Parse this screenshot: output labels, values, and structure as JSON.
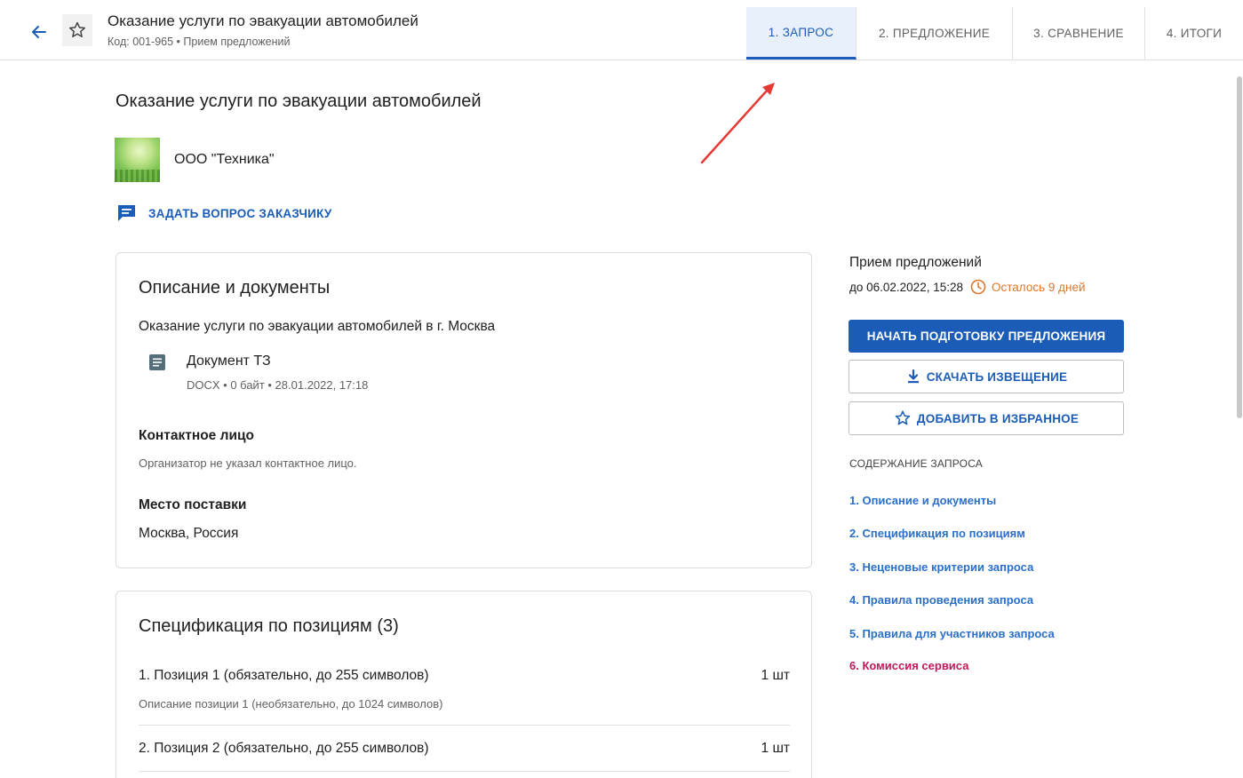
{
  "header": {
    "title": "Оказание услуги по эвакуации автомобилей",
    "subtitle": "Код: 001-965 • Прием предложений",
    "tabs": [
      {
        "label": "1. ЗАПРОС",
        "active": true
      },
      {
        "label": "2. ПРЕДЛОЖЕНИЕ",
        "active": false
      },
      {
        "label": "3. СРАВНЕНИЕ",
        "active": false
      },
      {
        "label": "4. ИТОГИ",
        "active": false
      }
    ]
  },
  "main": {
    "title": "Оказание услуги по эвакуации автомобилей",
    "organization": "ООО \"Техника\"",
    "ask_question_label": "ЗАДАТЬ ВОПРОС ЗАКАЗЧИКУ",
    "description_card": {
      "title": "Описание и документы",
      "text": "Оказание услуги по эвакуации автомобилей в г. Москва",
      "document_name": "Документ ТЗ",
      "document_meta": "DOCX  • 0 байт  • 28.01.2022, 17:18",
      "contact_label": "Контактное лицо",
      "contact_note": "Организатор не указал контактное лицо.",
      "delivery_label": "Место поставки",
      "delivery_value": "Москва, Россия"
    },
    "spec_card": {
      "title": "Спецификация по позициям (3)",
      "items": [
        {
          "name": "1. Позиция 1 (обязательно, до 255 символов)",
          "qty": "1 шт",
          "desc": "Описание позиции 1 (необязательно, до 1024 символов)"
        },
        {
          "name": "2. Позиция 2 (обязательно, до 255 символов)",
          "qty": "1 шт",
          "desc": ""
        }
      ]
    }
  },
  "sidebar": {
    "stage": "Прием предложений",
    "deadline": "до 06.02.2022, 15:28",
    "time_left": "Осталось 9 дней",
    "start_button": "НАЧАТЬ ПОДГОТОВКУ ПРЕДЛОЖЕНИЯ",
    "download_button": "СКАЧАТЬ ИЗВЕЩЕНИЕ",
    "favorite_button": "ДОБАВИТЬ В ИЗБРАННОЕ",
    "toc_title": "СОДЕРЖАНИЕ ЗАПРОСА",
    "toc": [
      "1. Описание и документы",
      "2. Спецификация по позициям",
      "3. Неценовые критерии запроса",
      "4. Правила проведения запроса",
      "5. Правила для участников запроса",
      "6. Комиссия сервиса"
    ]
  },
  "colors": {
    "accent": "#1a5cb8",
    "link": "#2a6fc9",
    "warning": "#e0762a",
    "pink_link": "#c2185b",
    "annotation_arrow": "#e53935"
  }
}
